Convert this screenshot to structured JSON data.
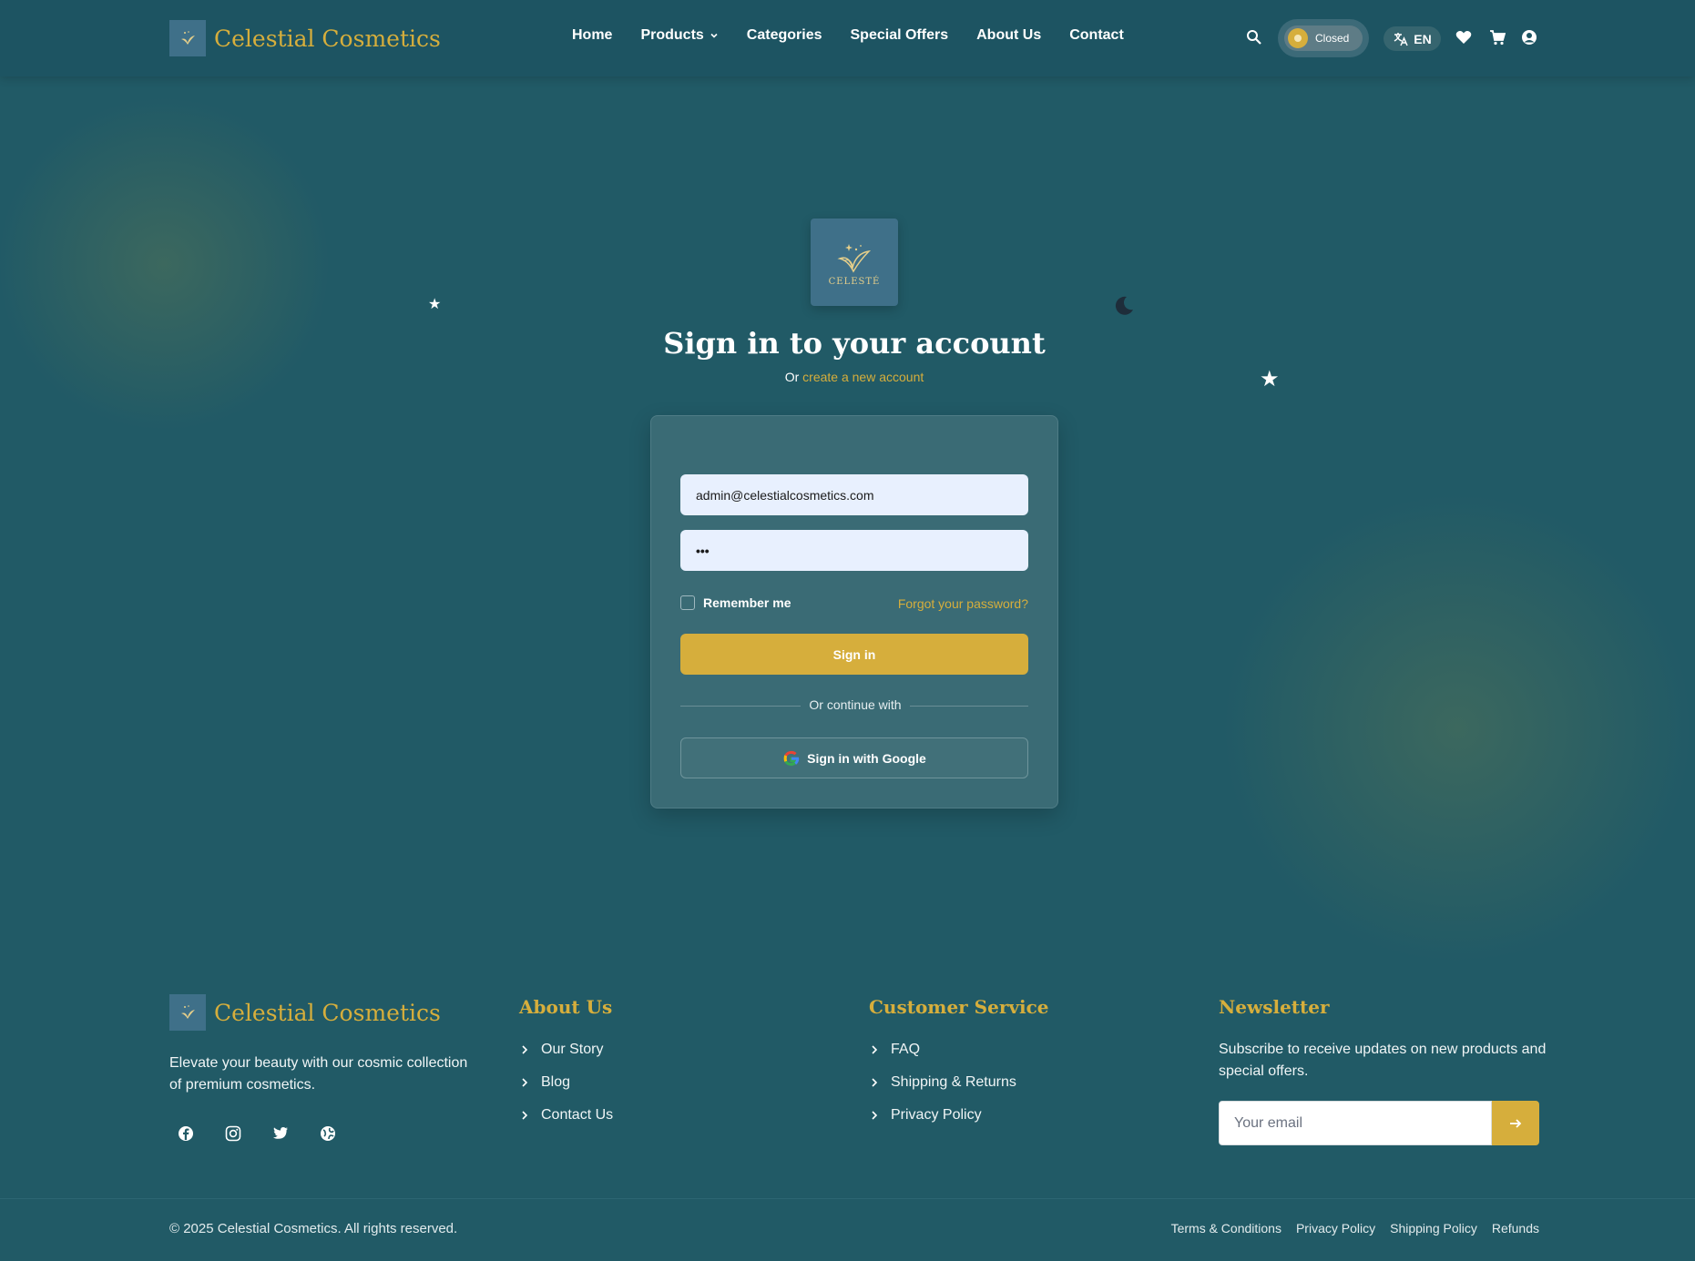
{
  "brand": {
    "name": "Celestial Cosmetics",
    "logo_text": "CELESTÉ"
  },
  "nav": {
    "items": [
      {
        "label": "Home"
      },
      {
        "label": "Products"
      },
      {
        "label": "Categories"
      },
      {
        "label": "Special Offers"
      },
      {
        "label": "About Us"
      },
      {
        "label": "Contact"
      }
    ],
    "store_status": "Closed",
    "language": "EN"
  },
  "signin": {
    "title": "Sign in to your account",
    "subtitle_prefix": "Or",
    "create_link": "create a new account",
    "email_value": "admin@celestialcosmetics.com",
    "password_value": "•••",
    "remember_label": "Remember me",
    "forgot_link": "Forgot your password?",
    "submit_label": "Sign in",
    "divider_label": "Or continue with",
    "google_label": "Sign in with Google"
  },
  "footer": {
    "description": "Elevate your beauty with our cosmic collection of premium cosmetics.",
    "about": {
      "title": "About Us",
      "links": [
        "Our Story",
        "Blog",
        "Contact Us"
      ]
    },
    "service": {
      "title": "Customer Service",
      "links": [
        "FAQ",
        "Shipping & Returns",
        "Privacy Policy"
      ]
    },
    "newsletter": {
      "title": "Newsletter",
      "description": "Subscribe to receive updates on new products and special offers.",
      "placeholder": "Your email"
    },
    "copyright": "© 2025 Celestial Cosmetics. All rights reserved.",
    "legal_links": [
      "Terms & Conditions",
      "Privacy Policy",
      "Shipping Policy",
      "Refunds"
    ]
  },
  "colors": {
    "background": "#215a66",
    "header": "#1d5462",
    "accent_gold": "#d6ae3c",
    "card": "#3a6b75",
    "logo_box": "#3f7089"
  }
}
